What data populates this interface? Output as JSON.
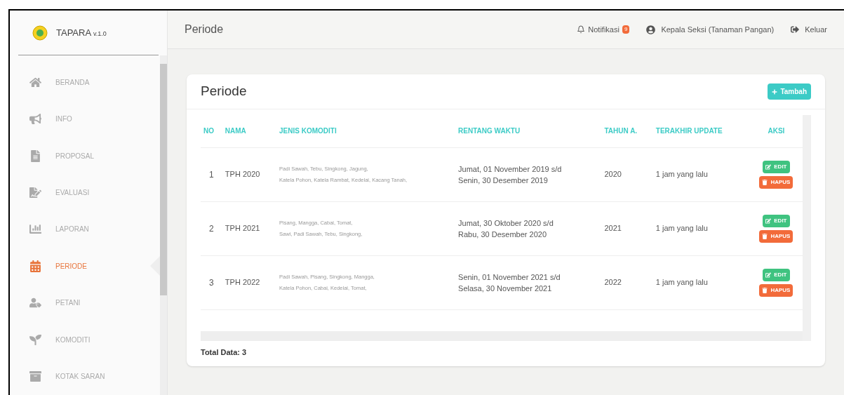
{
  "app": {
    "name": "TAPARA",
    "version": "v.1.0"
  },
  "sidebar": {
    "items": [
      {
        "label": "BERANDA",
        "selected": false
      },
      {
        "label": "INFO",
        "selected": false
      },
      {
        "label": "PROPOSAL",
        "selected": false
      },
      {
        "label": "EVALUASI",
        "selected": false
      },
      {
        "label": "LAPORAN",
        "selected": false
      },
      {
        "label": "PERIODE",
        "selected": true
      },
      {
        "label": "PETANI",
        "selected": false
      },
      {
        "label": "KOMODITI",
        "selected": false
      },
      {
        "label": "KOTAK SARAN",
        "selected": false
      }
    ]
  },
  "header": {
    "title": "Periode",
    "notification": {
      "label": "Notifikasi",
      "count": "9"
    },
    "user": "Kepala Seksi (Tanaman Pangan)",
    "logout": "Keluar"
  },
  "card": {
    "title": "Periode",
    "add_button": "Tambah",
    "table": {
      "columns": [
        "NO",
        "NAMA",
        "JENIS KOMODITI",
        "RENTANG WAKTU",
        "TAHUN A.",
        "TERAKHIR UPDATE",
        "AKSI"
      ],
      "rows": [
        {
          "no": "1",
          "nama": "TPH 2020",
          "komoditi": [
            "Padi Sawah, Tebu, Singkong, Jagung,",
            "Katela Pohon, Katela Rambat, Kedelai, Kacang Tanah,"
          ],
          "rentang": [
            "Jumat, 01 November 2019 s/d",
            "Senin, 30 Desember 2019"
          ],
          "tahun": "2020",
          "update": "1 jam yang lalu",
          "actions": [
            "EDIT",
            "HAPUS"
          ]
        },
        {
          "no": "2",
          "nama": "TPH 2021",
          "komoditi": [
            "Pisang, Mangga, Cabai, Tomat,",
            "Sawi, Padi Sawah, Tebu, Singkong,"
          ],
          "rentang": [
            "Jumat, 30 Oktober 2020 s/d",
            "Rabu, 30 Desember 2020"
          ],
          "tahun": "2021",
          "update": "1 jam yang lalu",
          "actions": [
            "EDIT",
            "HAPUS"
          ]
        },
        {
          "no": "3",
          "nama": "TPH 2022",
          "komoditi": [
            "Padi Sawah, Pisang, Singkong, Mangga,",
            "Katela Pohon, Cabai, Kedelai, Tomat,"
          ],
          "rentang": [
            "Senin, 01 November 2021 s/d",
            "Selasa, 30 November 2021"
          ],
          "tahun": "2022",
          "update": "1 jam yang lalu",
          "actions": [
            "EDIT",
            "HAPUS"
          ]
        }
      ]
    },
    "total": "Total Data: 3"
  }
}
